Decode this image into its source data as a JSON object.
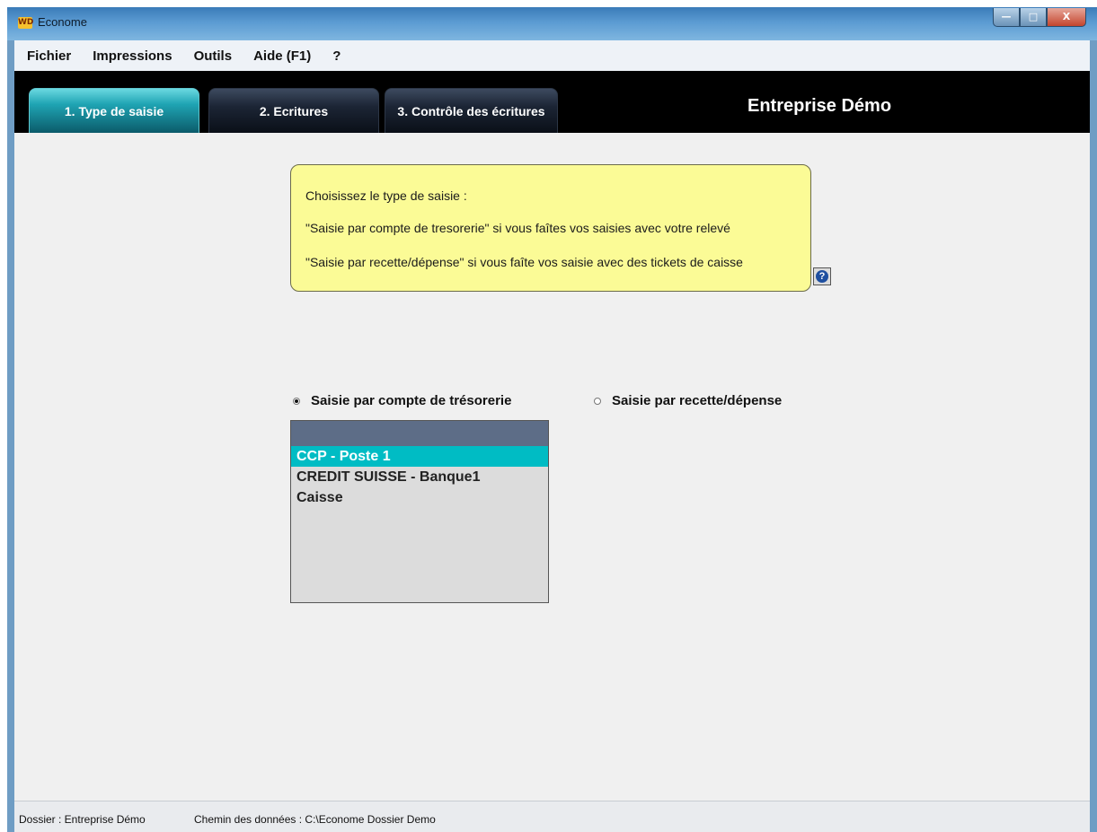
{
  "window": {
    "title": "Econome",
    "icon_text": "WD",
    "controls": {
      "minimize": "—",
      "maximize": "□",
      "close": "X"
    }
  },
  "menu": {
    "items": [
      "Fichier",
      "Impressions",
      "Outils",
      "Aide (F1)",
      "?"
    ]
  },
  "header": {
    "tabs": [
      {
        "label": "1. Type de saisie",
        "active": true
      },
      {
        "label": "2. Ecritures",
        "active": false
      },
      {
        "label": "3. Contrôle des écritures",
        "active": false
      }
    ],
    "company": "Entreprise Démo"
  },
  "info_note": {
    "lines": [
      "Choisissez le type de saisie :",
      "\"Saisie par compte de tresorerie\" si vous faîtes vos saisies avec votre relevé",
      "\"Saisie par recette/dépense\" si vous faîte vos saisie avec des tickets de caisse"
    ],
    "help_icon": "?"
  },
  "entry_type": {
    "options": [
      {
        "label": "Saisie par compte de trésorerie",
        "checked": true
      },
      {
        "label": "Saisie par recette/dépense",
        "checked": false
      }
    ]
  },
  "accounts": {
    "items": [
      {
        "label": "CCP - Poste 1",
        "selected": true
      },
      {
        "label": "CREDIT SUISSE - Banque1",
        "selected": false
      },
      {
        "label": "Caisse",
        "selected": false
      }
    ]
  },
  "status": {
    "dossier": "Dossier : Entreprise Démo",
    "path": "Chemin des données : C:\\Econome Dossier Demo"
  },
  "colors": {
    "active_tab": "#1fa4b3",
    "selection": "#00bcc4",
    "note_background": "#fbfb96",
    "header_background": "#000000"
  }
}
